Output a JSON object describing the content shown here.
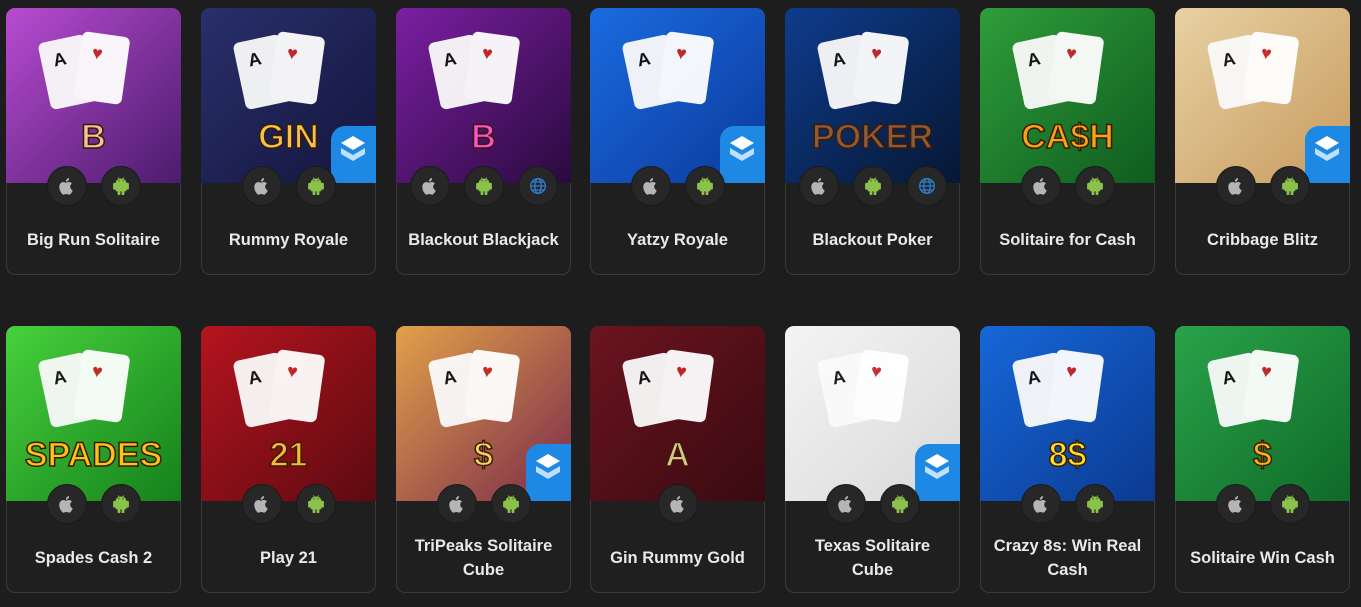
{
  "platform_icons": {
    "ios": "apple-icon",
    "android": "android-icon",
    "web": "globe-icon",
    "cube": "cube-logo-icon"
  },
  "colors": {
    "background": "#1d1d1d",
    "card_border": "#3a3a3a",
    "title_text": "#e9e9e9",
    "android_green": "#8bc34a",
    "apple_gray": "#b5b5b5",
    "web_blue": "#2f80d1",
    "cube_blue": "#1e88e5"
  },
  "games": [
    {
      "title": "Big Run Solitaire",
      "platforms": [
        "ios",
        "android"
      ],
      "art": {
        "bg1": "#b84bd1",
        "bg2": "#4b1c6d",
        "accent": "#f2c29b",
        "cube": false,
        "text": "B"
      }
    },
    {
      "title": "Rummy Royale",
      "platforms": [
        "ios",
        "android"
      ],
      "art": {
        "bg1": "#2a2f6b",
        "bg2": "#13163d",
        "accent": "#f4c34a",
        "cube": true,
        "text": "GIN"
      }
    },
    {
      "title": "Blackout Blackjack",
      "platforms": [
        "ios",
        "android",
        "web"
      ],
      "art": {
        "bg1": "#7b1fa2",
        "bg2": "#2a0a3e",
        "accent": "#ff4fd8",
        "cube": false,
        "text": "B"
      }
    },
    {
      "title": "Yatzy Royale",
      "platforms": [
        "ios",
        "android"
      ],
      "art": {
        "bg1": "#1a6be0",
        "bg2": "#0b3a9c",
        "accent": "#f1b27c",
        "cube": true,
        "text": ""
      }
    },
    {
      "title": "Blackout Poker",
      "platforms": [
        "ios",
        "android",
        "web"
      ],
      "art": {
        "bg1": "#0e3c8c",
        "bg2": "#061733",
        "accent": "#8c5a3b",
        "cube": false,
        "text": "POKER"
      }
    },
    {
      "title": "Solitaire for Cash",
      "platforms": [
        "ios",
        "android"
      ],
      "art": {
        "bg1": "#2e9d3a",
        "bg2": "#0f5c1f",
        "accent": "#f7a21b",
        "cube": false,
        "text": "CA$H"
      }
    },
    {
      "title": "Cribbage Blitz",
      "platforms": [
        "ios",
        "android"
      ],
      "art": {
        "bg1": "#e8d1a3",
        "bg2": "#c79b5e",
        "accent": "#d93a3a",
        "cube": true,
        "text": ""
      }
    },
    {
      "title": "Spades Cash 2",
      "platforms": [
        "ios",
        "android"
      ],
      "art": {
        "bg1": "#47d13b",
        "bg2": "#15811d",
        "accent": "#ffc21a",
        "cube": false,
        "text": "SPADES"
      }
    },
    {
      "title": "Play 21",
      "platforms": [
        "ios",
        "android"
      ],
      "art": {
        "bg1": "#b5141f",
        "bg2": "#5d0a10",
        "accent": "#f5b83a",
        "cube": false,
        "text": "21"
      }
    },
    {
      "title": "TriPeaks Solitaire Cube",
      "platforms": [
        "ios",
        "android"
      ],
      "art": {
        "bg1": "#e2a14a",
        "bg2": "#7a2a4a",
        "accent": "#f2d36b",
        "cube": true,
        "text": "$"
      }
    },
    {
      "title": "Gin Rummy Gold",
      "platforms": [
        "ios"
      ],
      "art": {
        "bg1": "#6b1420",
        "bg2": "#3a0a10",
        "accent": "#d8c58a",
        "cube": false,
        "text": "A"
      }
    },
    {
      "title": "Texas Solitaire Cube",
      "platforms": [
        "ios",
        "android"
      ],
      "art": {
        "bg1": "#f4f4f4",
        "bg2": "#d9d9d9",
        "accent": "#0d2b55",
        "cube": true,
        "text": ""
      }
    },
    {
      "title": "Crazy 8s: Win Real Cash",
      "platforms": [
        "ios",
        "android"
      ],
      "art": {
        "bg1": "#1667d8",
        "bg2": "#0b3a91",
        "accent": "#ffe02a",
        "cube": false,
        "text": "8$"
      }
    },
    {
      "title": "Solitaire Win Cash",
      "platforms": [
        "ios",
        "android"
      ],
      "art": {
        "bg1": "#2aa34a",
        "bg2": "#0f6a28",
        "accent": "#f7b21a",
        "cube": false,
        "text": "$"
      }
    }
  ]
}
